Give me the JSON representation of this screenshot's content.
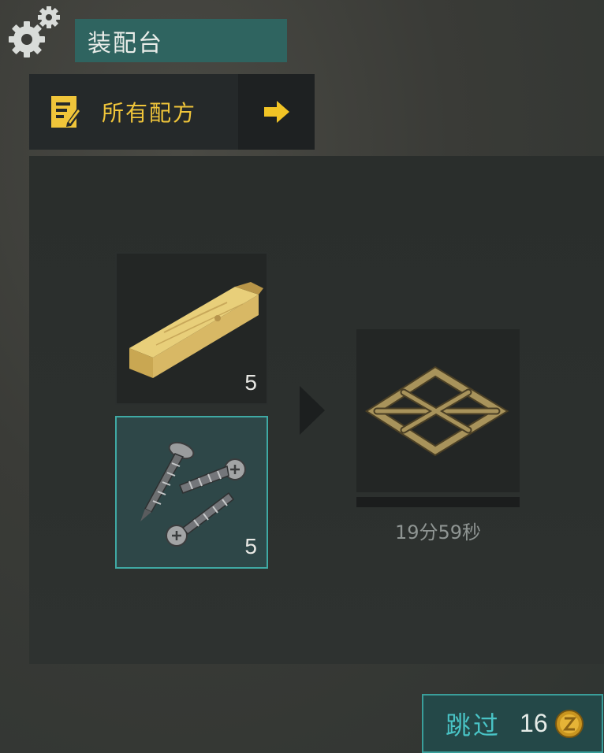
{
  "header": {
    "title": "装配台"
  },
  "recipe_bar": {
    "label": "所有配方"
  },
  "ingredients": [
    {
      "name": "wooden-plank",
      "count": "5",
      "selected": false
    },
    {
      "name": "screws",
      "count": "5",
      "selected": true
    }
  ],
  "result": {
    "name": "wooden-frame",
    "progress_fraction": 0.0,
    "timer": "19分59秒"
  },
  "skip": {
    "label": "跳过",
    "cost": "16"
  },
  "colors": {
    "accent_teal": "#3fa9a4",
    "recipe_gold": "#f0c53a",
    "title_bg": "#2f6460"
  }
}
